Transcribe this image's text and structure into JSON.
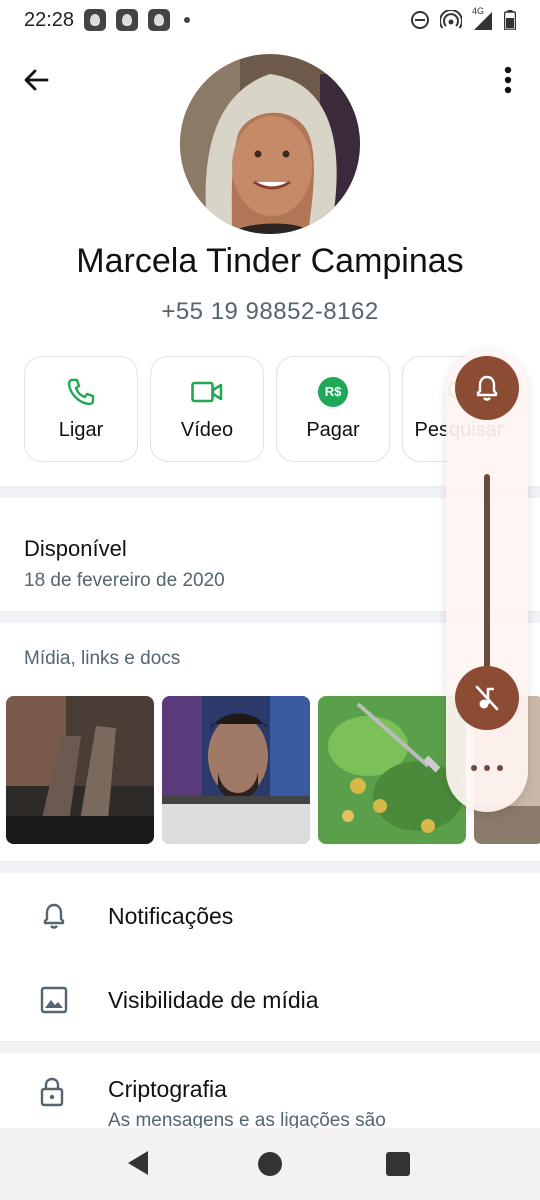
{
  "status_bar": {
    "time": "22:28",
    "network": "4G"
  },
  "contact": {
    "name": "Marcela Tinder Campinas",
    "phone": "+55 19 98852-8162"
  },
  "actions": [
    {
      "label": "Ligar",
      "icon": "phone-icon"
    },
    {
      "label": "Vídeo",
      "icon": "video-icon"
    },
    {
      "label": "Pagar",
      "icon": "pay-icon",
      "icon_text": "R$"
    },
    {
      "label": "Pesquisar",
      "icon": "search-icon"
    }
  ],
  "about": {
    "title": "Disponível",
    "date": "18 de fevereiro de 2020"
  },
  "media": {
    "header": "Mídia, links e docs",
    "thumbnails": [
      "legs-photo",
      "man-portrait-photo",
      "salad-photo",
      "partial-photo"
    ]
  },
  "settings": [
    {
      "label": "Notificações",
      "icon": "bell-icon"
    },
    {
      "label": "Visibilidade de mídia",
      "icon": "image-icon"
    }
  ],
  "encryption": {
    "title": "Criptografia",
    "subtitle": "As mensagens e as ligações são"
  },
  "volume_panel": {
    "ringer_icon": "bell-icon",
    "media_icon": "music-muted-icon",
    "level": 0
  },
  "colors": {
    "accent_green": "#1fa855",
    "volume_accent": "#8c4b33",
    "text_secondary": "#54656f"
  }
}
